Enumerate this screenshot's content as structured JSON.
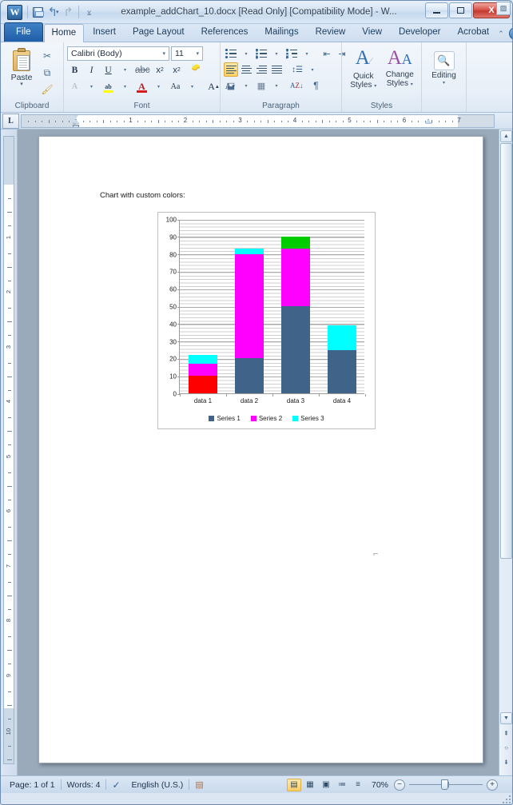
{
  "window": {
    "title": "example_addChart_10.docx [Read Only] [Compatibility Mode] - W...",
    "app_logo": "W",
    "minimize_label": "Minimize",
    "maximize_label": "Maximize",
    "close_label": "X"
  },
  "quick_access": {
    "save": "save-icon",
    "undo": "↺",
    "redo": "↻",
    "customize": "▾"
  },
  "tabs": [
    {
      "label": "File",
      "active": false,
      "file": true
    },
    {
      "label": "Home",
      "active": true
    },
    {
      "label": "Insert",
      "active": false
    },
    {
      "label": "Page Layout",
      "active": false
    },
    {
      "label": "References",
      "active": false
    },
    {
      "label": "Mailings",
      "active": false
    },
    {
      "label": "Review",
      "active": false
    },
    {
      "label": "View",
      "active": false
    },
    {
      "label": "Developer",
      "active": false
    },
    {
      "label": "Acrobat",
      "active": false
    }
  ],
  "ribbon_right": {
    "minimize_ribbon": "⌃",
    "help": "?"
  },
  "ribbon": {
    "clipboard": {
      "label": "Clipboard",
      "paste_label": "Paste",
      "paste_caret": "▾",
      "cut": "✂",
      "copy": "⧉",
      "format_painter": "🖌",
      "dialog_launcher": "⌐"
    },
    "font": {
      "label": "Font",
      "font_name": "Calibri (Body)",
      "font_size": "11",
      "bold": "B",
      "italic": "I",
      "underline": "U",
      "strikethrough": "abc",
      "subscript": "x",
      "superscript": "x",
      "text_effects": "A",
      "highlight": "ab",
      "font_color": "A",
      "change_case": "Aa",
      "grow_font": "A",
      "shrink_font": "A",
      "clear_formatting": "A",
      "dialog_launcher": "⌐"
    },
    "paragraph": {
      "label": "Paragraph",
      "bullets": "bullets-icon",
      "numbering": "numbering-icon",
      "multilevel": "multilevel-list-icon",
      "decrease_indent": "decrease-indent-icon",
      "increase_indent": "increase-indent-icon",
      "align_left": "align-left-icon",
      "align_center": "align-center-icon",
      "align_right": "align-right-icon",
      "justify": "justify-icon",
      "line_spacing": "line-spacing-icon",
      "shading": "shading-icon",
      "borders": "borders-icon",
      "sort": "sort-icon",
      "show_marks": "¶",
      "dialog_launcher": "⌐"
    },
    "styles": {
      "label": "Styles",
      "quick_styles": "Quick\nStyles",
      "quick_styles_l1": "Quick",
      "quick_styles_l2": "Styles",
      "change_styles_l1": "Change",
      "change_styles_l2": "Styles",
      "caret": "▾",
      "dialog_launcher": "⌐"
    },
    "editing": {
      "label": "Editing",
      "editing_label": "Editing",
      "caret": "▾",
      "icon": "find-binoculars-icon"
    }
  },
  "ruler": {
    "tab_selector": "L",
    "horizontal_numbers": [
      "1",
      "1",
      "2",
      "3",
      "4",
      "5",
      "6",
      "7"
    ],
    "vertical_numbers": [
      "1",
      "2",
      "3",
      "4",
      "5",
      "6",
      "7",
      "8",
      "9",
      "10"
    ],
    "corner_icon": "view-ruler-icon"
  },
  "document": {
    "paragraph_text": "Chart with custom colors:",
    "cursor_mark": "⌐"
  },
  "chart_data": {
    "type": "bar",
    "stacked": true,
    "title": "",
    "xlabel": "",
    "ylabel": "",
    "ylim": [
      0,
      100
    ],
    "ytick_step": 10,
    "yticks": [
      0,
      10,
      20,
      30,
      40,
      50,
      60,
      70,
      80,
      90,
      100
    ],
    "grid": true,
    "minor_grid": true,
    "legend_position": "bottom",
    "categories": [
      "data 1",
      "data 2",
      "data 3",
      "data 4"
    ],
    "series": [
      {
        "name": "Series 1",
        "values": [
          10,
          20,
          50,
          25
        ],
        "legend_color": "#3f6389",
        "point_colors": [
          "#ff0000",
          "#3f6389",
          "#3f6389",
          "#3f6389"
        ]
      },
      {
        "name": "Series 2",
        "values": [
          7,
          60,
          33,
          0
        ],
        "legend_color": "#ff00ff",
        "point_colors": [
          "#ff00ff",
          "#ff00ff",
          "#ff00ff",
          "#ff00ff"
        ]
      },
      {
        "name": "Series 3",
        "values": [
          5,
          3,
          7,
          14
        ],
        "legend_color": "#00ffff",
        "point_colors": [
          "#00ffff",
          "#00ffff",
          "#00cc00",
          "#00ffff"
        ]
      }
    ],
    "totals": [
      22,
      83,
      90,
      39
    ]
  },
  "scrollbar": {
    "up_arrow": "▲",
    "down_arrow": "▼",
    "previous_page": "⇞",
    "select_browse_object": "○",
    "next_page": "⇟"
  },
  "statusbar": {
    "page": "Page: 1 of 1",
    "words": "Words: 4",
    "proofing_icon": "proofing-errors-icon",
    "language": "English (U.S.)",
    "macro_icon": "macro-record-icon",
    "views": [
      {
        "name": "print-layout",
        "glyph": "▤",
        "active": true
      },
      {
        "name": "full-screen-reading",
        "glyph": "▦",
        "active": false
      },
      {
        "name": "web-layout",
        "glyph": "▣",
        "active": false
      },
      {
        "name": "outline",
        "glyph": "≔",
        "active": false
      },
      {
        "name": "draft",
        "glyph": "≡",
        "active": false
      }
    ],
    "zoom": "70%",
    "zoom_out": "−",
    "zoom_in": "+"
  }
}
